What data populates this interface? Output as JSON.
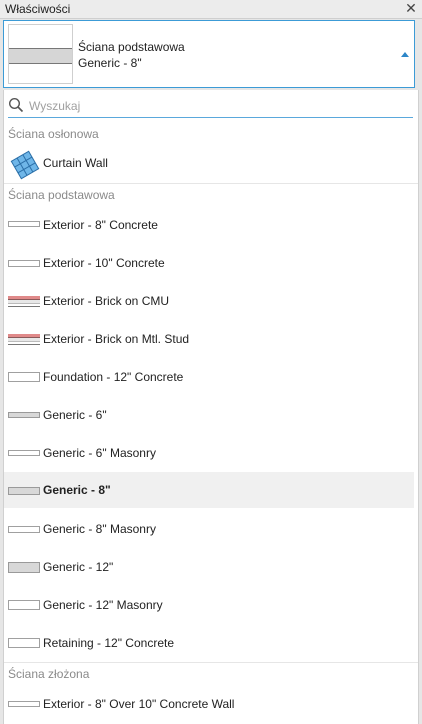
{
  "window": {
    "title": "Właściwości",
    "close_icon": "close-icon"
  },
  "selector": {
    "family": "Ściana podstawowa",
    "type": "Generic - 8\"",
    "arrow_icon": "dropdown-arrow-icon"
  },
  "search": {
    "placeholder": "Wyszukaj",
    "value": ""
  },
  "groups": [
    {
      "header": "Ściana osłonowa",
      "items": [
        {
          "label": "Curtain Wall",
          "icon": "curtain-wall-icon"
        }
      ]
    },
    {
      "header": "Ściana podstawowa",
      "items": [
        {
          "label": "Exterior - 8\" Concrete",
          "icon": "wall-thin-icon"
        },
        {
          "label": "Exterior - 10\" Concrete",
          "icon": "wall-thin-icon"
        },
        {
          "label": "Exterior - Brick on CMU",
          "icon": "wall-brick-icon"
        },
        {
          "label": "Exterior - Brick on Mtl. Stud",
          "icon": "wall-brick-icon"
        },
        {
          "label": "Foundation - 12\" Concrete",
          "icon": "wall-thick-icon"
        },
        {
          "label": "Generic - 6\"",
          "icon": "wall-gray-icon"
        },
        {
          "label": "Generic - 6\" Masonry",
          "icon": "wall-thin-icon"
        },
        {
          "label": "Generic - 8\"",
          "icon": "wall-gray-icon",
          "selected": true
        },
        {
          "label": "Generic - 8\" Masonry",
          "icon": "wall-thin-icon"
        },
        {
          "label": "Generic - 12\"",
          "icon": "wall-gray-icon"
        },
        {
          "label": "Generic - 12\" Masonry",
          "icon": "wall-thick-icon"
        },
        {
          "label": "Retaining - 12\" Concrete",
          "icon": "wall-thick-icon"
        }
      ]
    },
    {
      "header": "Ściana złożona",
      "items": [
        {
          "label": "Exterior - 8\" Over 10\" Concrete Wall",
          "icon": "wall-thin-icon"
        }
      ]
    }
  ],
  "colors": {
    "accent": "#3c9bd6",
    "selected_bg": "#f0f0f0"
  }
}
